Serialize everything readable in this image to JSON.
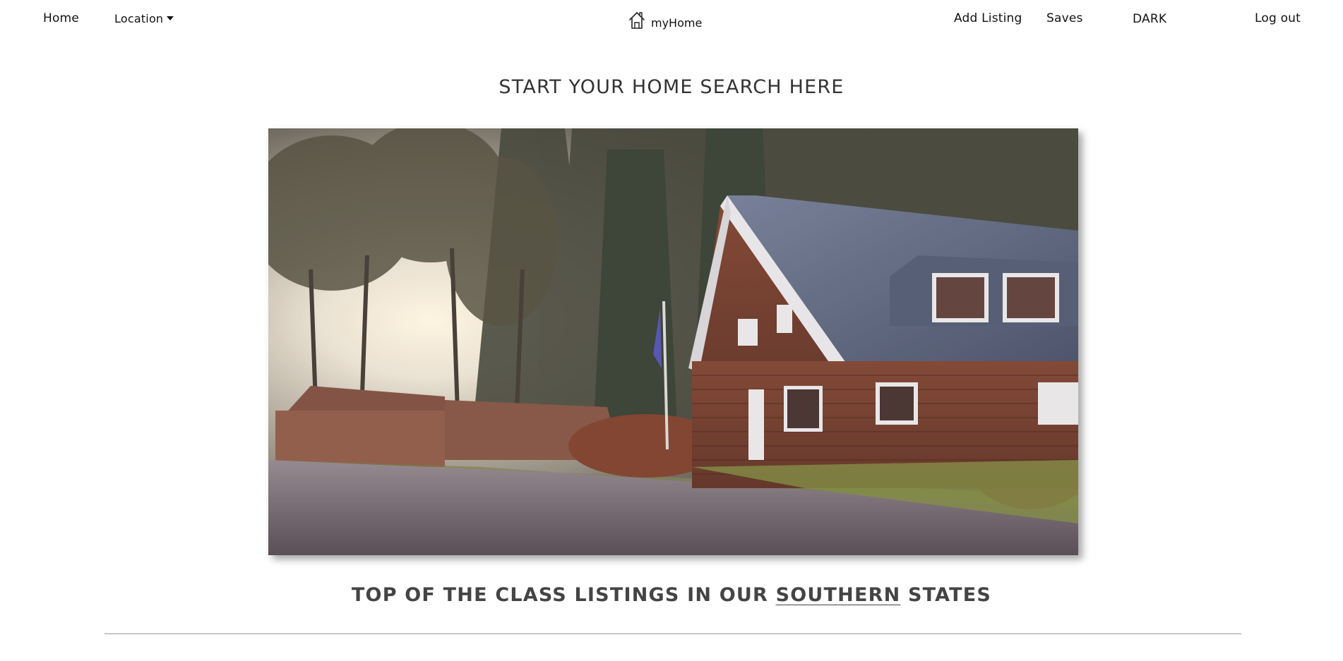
{
  "nav": {
    "home_label": "Home",
    "location_label": "Location",
    "brand_label": "myHome",
    "add_listing_label": "Add Listing",
    "saves_label": "Saves",
    "theme_toggle_label": "DARK",
    "logout_label": "Log out"
  },
  "icons": {
    "brand": "house-outline-icon",
    "location_caret": "caret-down-icon"
  },
  "hero": {
    "title": "START YOUR HOME SEARCH HERE",
    "image_subject": "house-photo"
  },
  "listings": {
    "title_prefix": "TOP OF THE CLASS LISTINGS IN OUR ",
    "region": "SOUTHERN",
    "title_suffix": " STATES"
  },
  "colors": {
    "background": "#ffffff",
    "text": "#111111",
    "heading": "#333333",
    "divider": "#9a9a9a"
  }
}
